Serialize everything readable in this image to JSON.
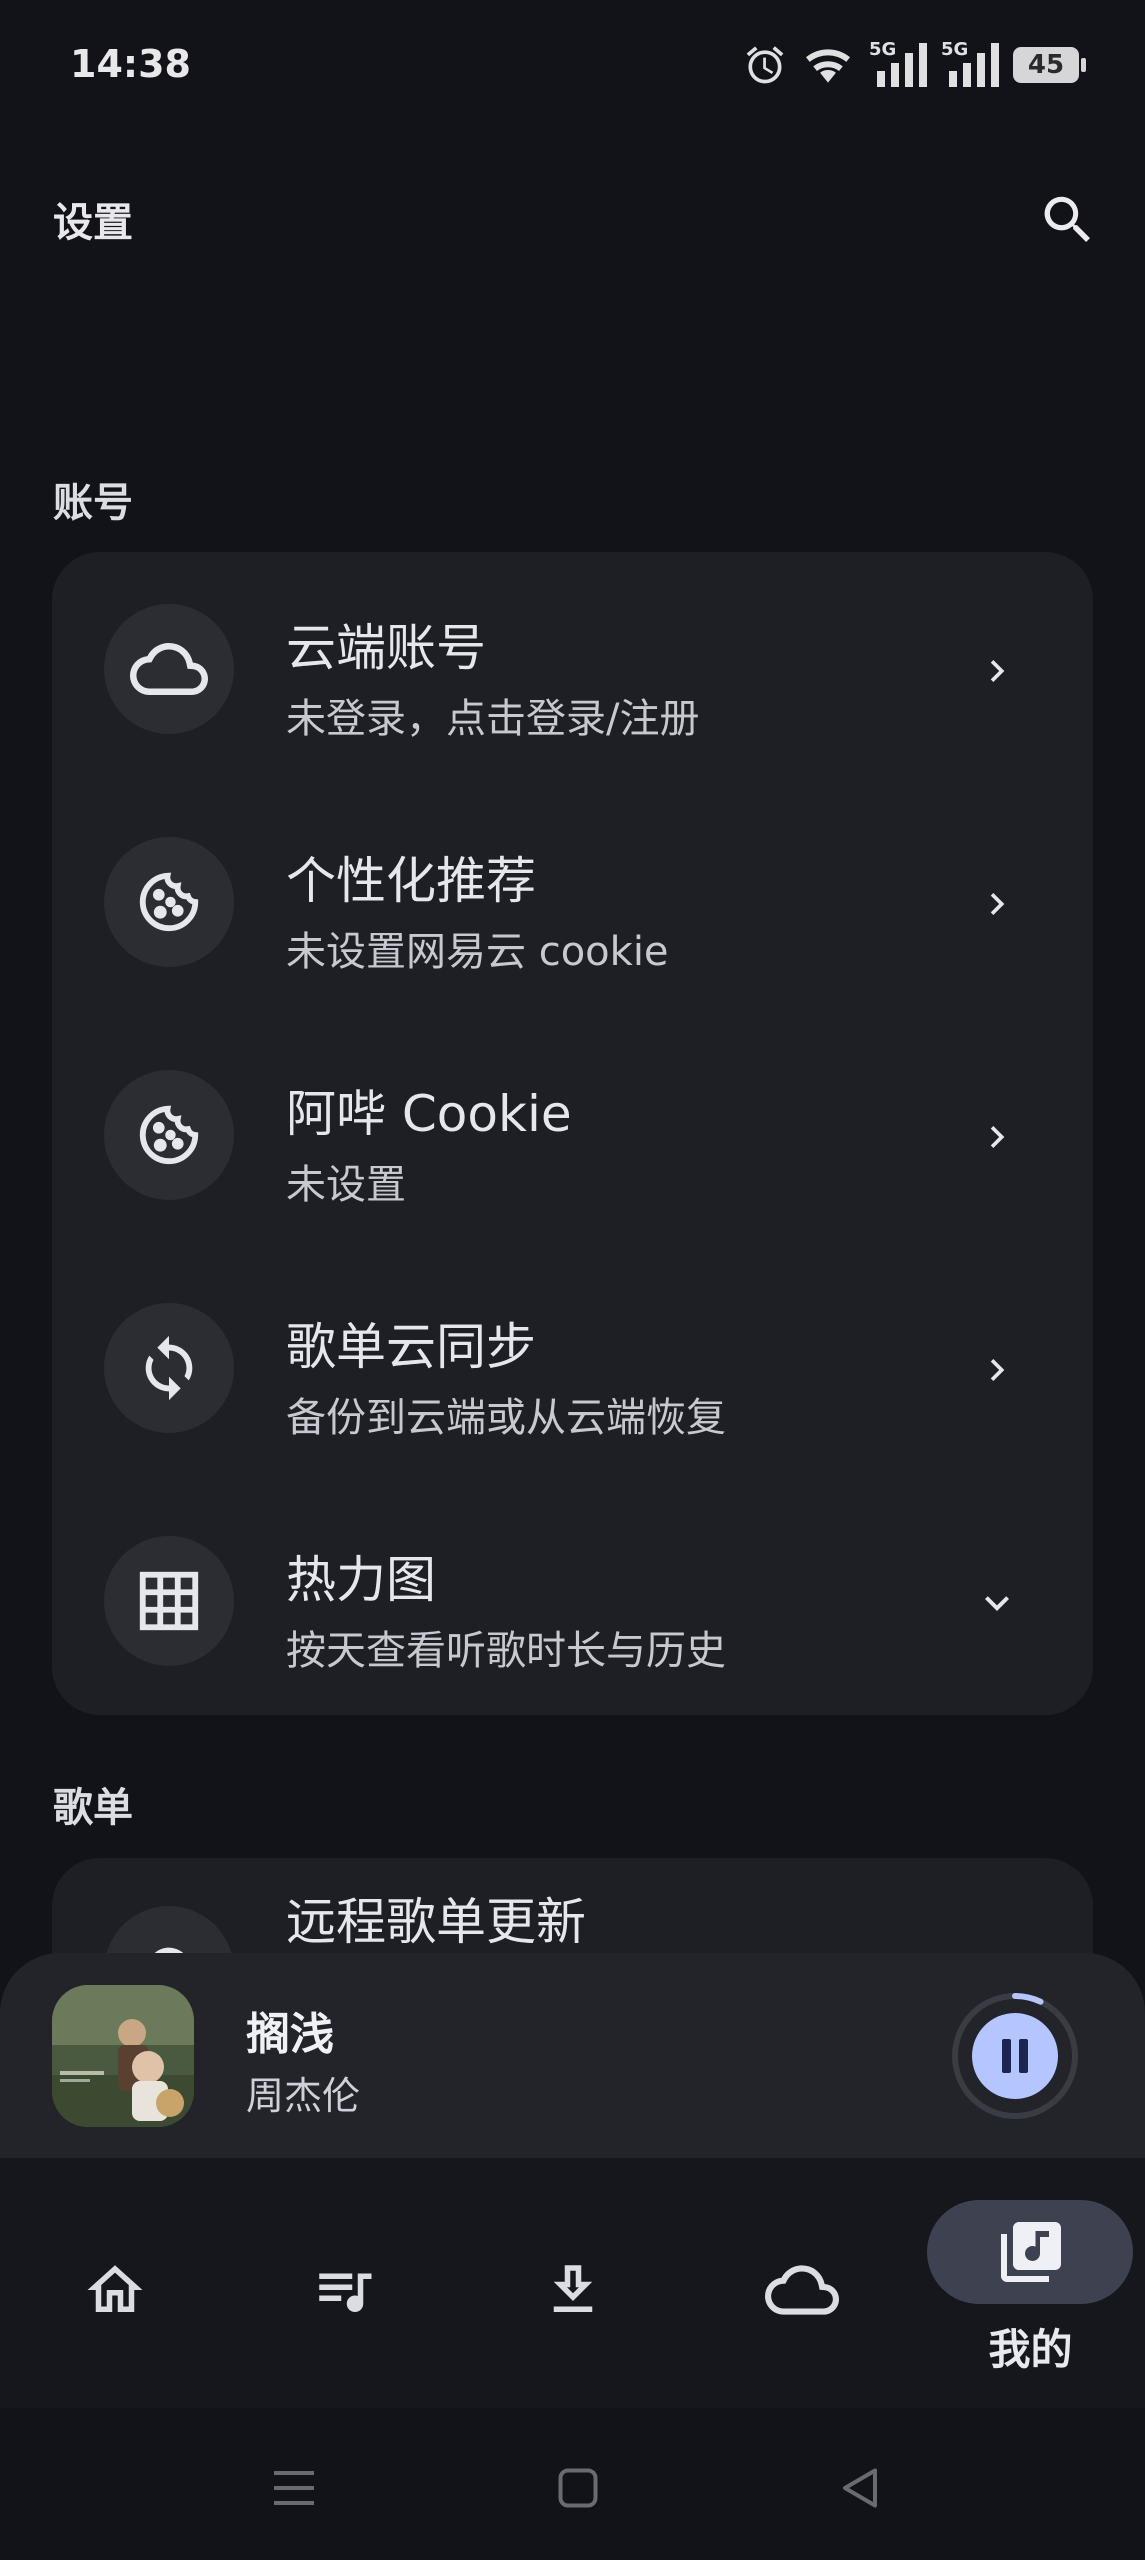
{
  "status_bar": {
    "time": "14:38",
    "network_1": "5G",
    "network_2": "5G",
    "battery": "45"
  },
  "app_bar": {
    "title": "设置",
    "search_icon": "search-icon"
  },
  "sections": {
    "account": {
      "header": "账号",
      "items": [
        {
          "title": "云端账号",
          "subtitle": "未登录，点击登录/注册",
          "icon": "cloud-icon",
          "trailing": "chevron-right-icon"
        },
        {
          "title": "个性化推荐",
          "subtitle": "未设置网易云 cookie",
          "icon": "cookie-icon",
          "trailing": "chevron-right-icon"
        },
        {
          "title": "阿哔 Cookie",
          "subtitle": "未设置",
          "icon": "cookie-icon",
          "trailing": "chevron-right-icon"
        },
        {
          "title": "歌单云同步",
          "subtitle": "备份到云端或从云端恢复",
          "icon": "sync-icon",
          "trailing": "chevron-right-icon"
        },
        {
          "title": "热力图",
          "subtitle": "按天查看听歌时长与历史",
          "icon": "grid-icon",
          "trailing": "chevron-down-icon"
        }
      ]
    },
    "playlist": {
      "header": "歌单",
      "items": [
        {
          "title": "远程歌单更新",
          "icon": "cloud-icon"
        }
      ]
    }
  },
  "player": {
    "title": "搁浅",
    "artist": "周杰伦",
    "state": "playing",
    "progress": 0.07
  },
  "bottom_nav": {
    "items": [
      {
        "icon": "home-icon",
        "label": ""
      },
      {
        "icon": "playlist-icon",
        "label": ""
      },
      {
        "icon": "download-icon",
        "label": ""
      },
      {
        "icon": "cloud-icon",
        "label": ""
      },
      {
        "icon": "library-music-icon",
        "label": "我的",
        "selected": true
      }
    ]
  },
  "colors": {
    "background": "#121318",
    "card": "#1e1f24",
    "accent": "#b4c5ff",
    "nav_selected": "#3d4150"
  }
}
